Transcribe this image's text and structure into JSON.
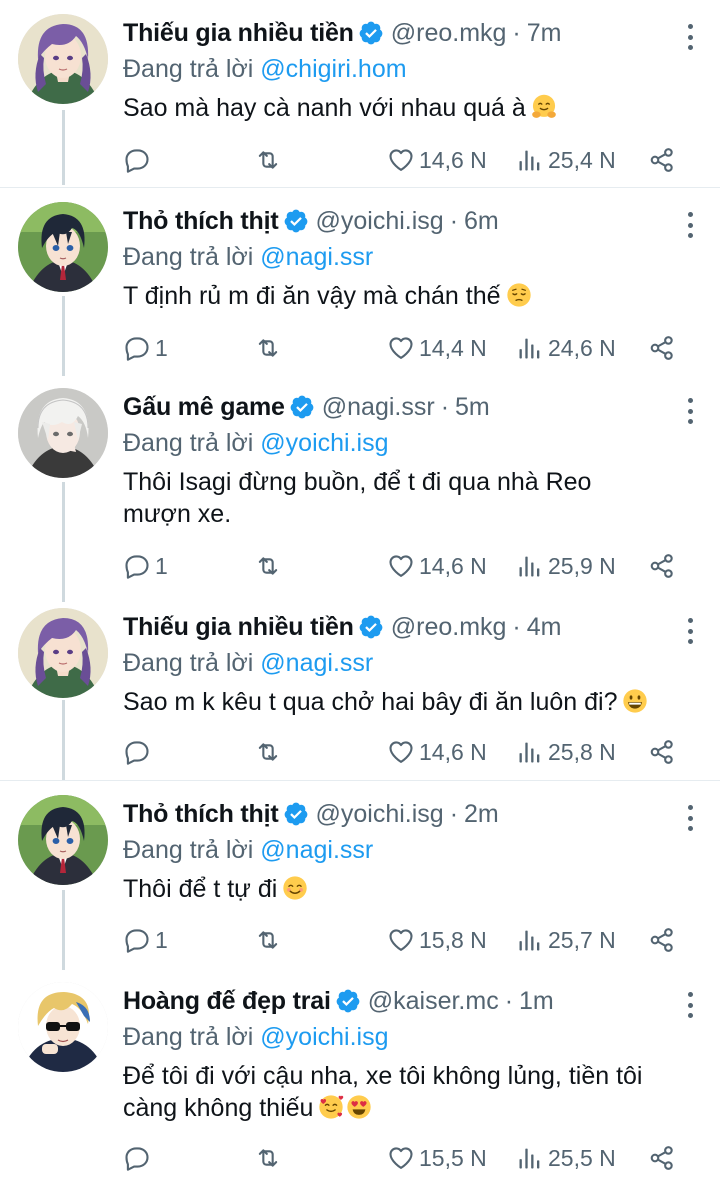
{
  "tweets": [
    {
      "name": "Thiếu gia nhiều tiền",
      "handle": "@reo.mkg",
      "separator": "·",
      "time": "7m",
      "reply_prefix": "Đang trả lời",
      "reply_to": "@chigiri.hom",
      "text": "Sao mà hay cà nanh với nhau quá à",
      "emoji": [
        "hugging-face"
      ],
      "replies": "",
      "likes": "14,6 N",
      "views": "25,4 N",
      "avatar": "reo"
    },
    {
      "name": "Thỏ thích thịt",
      "handle": "@yoichi.isg",
      "separator": "·",
      "time": "6m",
      "reply_prefix": "Đang trả lời",
      "reply_to": "@nagi.ssr",
      "text": "T định rủ m đi ăn vậy mà chán thế",
      "emoji": [
        "pensive-face"
      ],
      "replies": "1",
      "likes": "14,4 N",
      "views": "24,6 N",
      "avatar": "isagi"
    },
    {
      "name": "Gấu mê game",
      "handle": "@nagi.ssr",
      "separator": "·",
      "time": "5m",
      "reply_prefix": "Đang trả lời",
      "reply_to": "@yoichi.isg",
      "text": "Thôi Isagi đừng buồn, để t đi qua nhà Reo mượn xe.",
      "emoji": [],
      "replies": "1",
      "likes": "14,6 N",
      "views": "25,9 N",
      "avatar": "nagi"
    },
    {
      "name": "Thiếu gia nhiều tiền",
      "handle": "@reo.mkg",
      "separator": "·",
      "time": "4m",
      "reply_prefix": "Đang trả lời",
      "reply_to": "@nagi.ssr",
      "text": "Sao m k kêu t qua chở hai bây đi ăn luôn đi?",
      "emoji": [
        "grinning-face"
      ],
      "replies": "",
      "likes": "14,6 N",
      "views": "25,8 N",
      "avatar": "reo"
    },
    {
      "name": "Thỏ thích thịt",
      "handle": "@yoichi.isg",
      "separator": "·",
      "time": "2m",
      "reply_prefix": "Đang trả lời",
      "reply_to": "@nagi.ssr",
      "text": "Thôi để t tự đi",
      "emoji": [
        "smiling-eyes-face"
      ],
      "replies": "1",
      "likes": "15,8 N",
      "views": "25,7 N",
      "avatar": "isagi"
    },
    {
      "name": "Hoàng đế đẹp trai",
      "handle": "@kaiser.mc",
      "separator": "·",
      "time": "1m",
      "reply_prefix": "Đang trả lời",
      "reply_to": "@yoichi.isg",
      "text": "Để tôi đi với cậu nha, xe tôi không lủng, tiền tôi càng không thiếu",
      "emoji": [
        "smiling-face-with-hearts",
        "heart-eyes-face"
      ],
      "replies": "",
      "likes": "15,5 N",
      "views": "25,5 N",
      "avatar": "kaiser"
    }
  ],
  "colors": {
    "link": "#1d9bf0",
    "muted": "#536471",
    "text": "#0f1419",
    "divider": "#e6ecf0",
    "thread_line": "#cfd9de"
  },
  "icons": {
    "reply": "reply-icon",
    "retweet": "retweet-icon",
    "like": "heart-icon",
    "views": "views-icon",
    "share": "share-icon",
    "verified": "verified-badge-icon",
    "more": "more-options-icon"
  }
}
